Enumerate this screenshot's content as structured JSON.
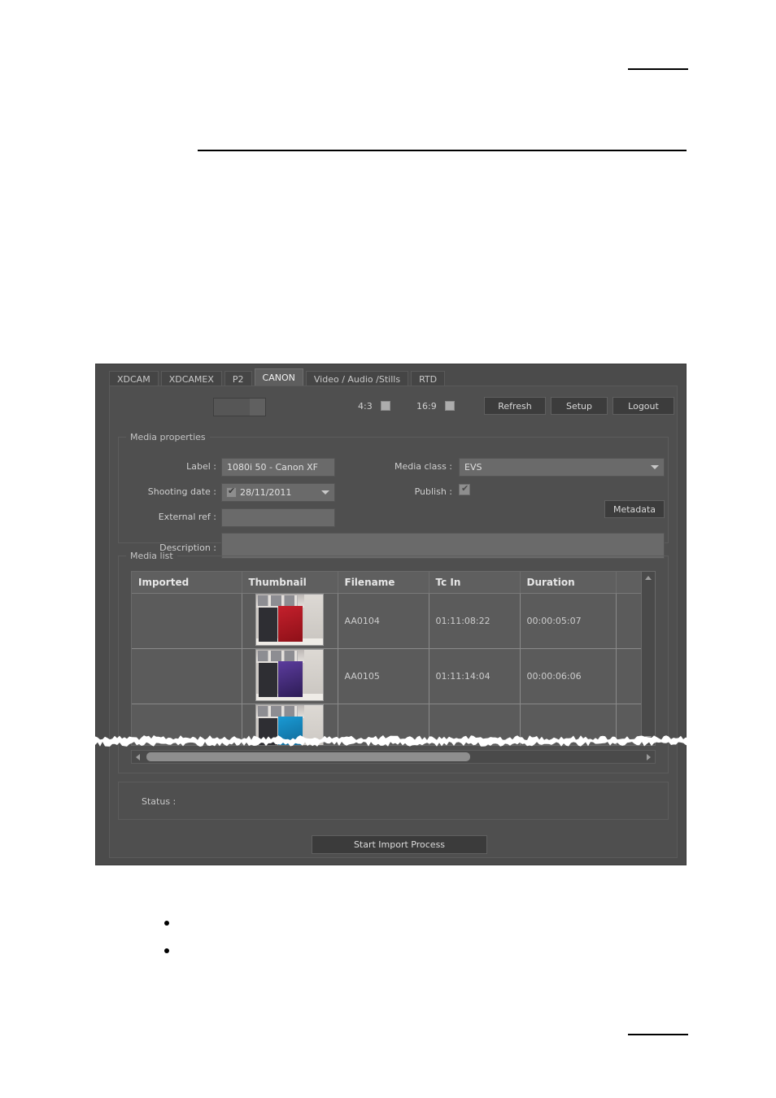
{
  "document": {
    "bullets": [
      "",
      ""
    ]
  },
  "app": {
    "tabs": [
      {
        "label": "XDCAM",
        "active": false
      },
      {
        "label": "XDCAMEX",
        "active": false
      },
      {
        "label": "P2",
        "active": false
      },
      {
        "label": "CANON",
        "active": true
      },
      {
        "label": "Video / Audio /Stills",
        "active": false
      },
      {
        "label": "RTD",
        "active": false
      }
    ],
    "toolbar": {
      "source_combo_value": "",
      "aspect_43_label": "4:3",
      "aspect_43_checked": false,
      "aspect_169_label": "16:9",
      "aspect_169_checked": false,
      "refresh_label": "Refresh",
      "setup_label": "Setup",
      "logout_label": "Logout"
    },
    "media_properties": {
      "group_title": "Media properties",
      "label_label": "Label :",
      "label_value": "1080i 50 - Canon XF",
      "shooting_date_label": "Shooting date :",
      "shooting_date_value": "28/11/2011",
      "shooting_date_checked": true,
      "external_ref_label": "External ref :",
      "external_ref_value": "",
      "description_label": "Description :",
      "description_value": "",
      "media_class_label": "Media class :",
      "media_class_value": "EVS",
      "publish_label": "Publish :",
      "publish_checked": true,
      "metadata_button": "Metadata"
    },
    "media_list": {
      "group_title": "Media list",
      "columns": [
        "Imported",
        "Thumbnail",
        "Filename",
        "Tc In",
        "Duration",
        ""
      ],
      "rows": [
        {
          "imported": "",
          "thumb_style": "tm-red",
          "filename": "AA0104",
          "tc_in": "01:11:08:22",
          "duration": "00:00:05:07",
          "extra": ""
        },
        {
          "imported": "",
          "thumb_style": "tm-purple",
          "filename": "AA0105",
          "tc_in": "01:11:14:04",
          "duration": "00:00:06:06",
          "extra": ""
        },
        {
          "imported": "",
          "thumb_style": "tm-blue",
          "filename": "",
          "tc_in": "",
          "duration": "",
          "extra": ""
        }
      ]
    },
    "status": {
      "label": "Status :",
      "value": ""
    },
    "footer": {
      "start_import_label": "Start Import Process"
    },
    "colors": {
      "window_bg": "#4b4b4b",
      "panel_bg": "#4f4f4f",
      "field_bg": "#6a6a6a",
      "button_bg": "#3c3c3c",
      "table_row_bg": "#5b5b5b",
      "table_header_bg": "#5f5f5f",
      "text": "#d2d2d2",
      "active_tab_bg": "#5e5e5e"
    }
  }
}
